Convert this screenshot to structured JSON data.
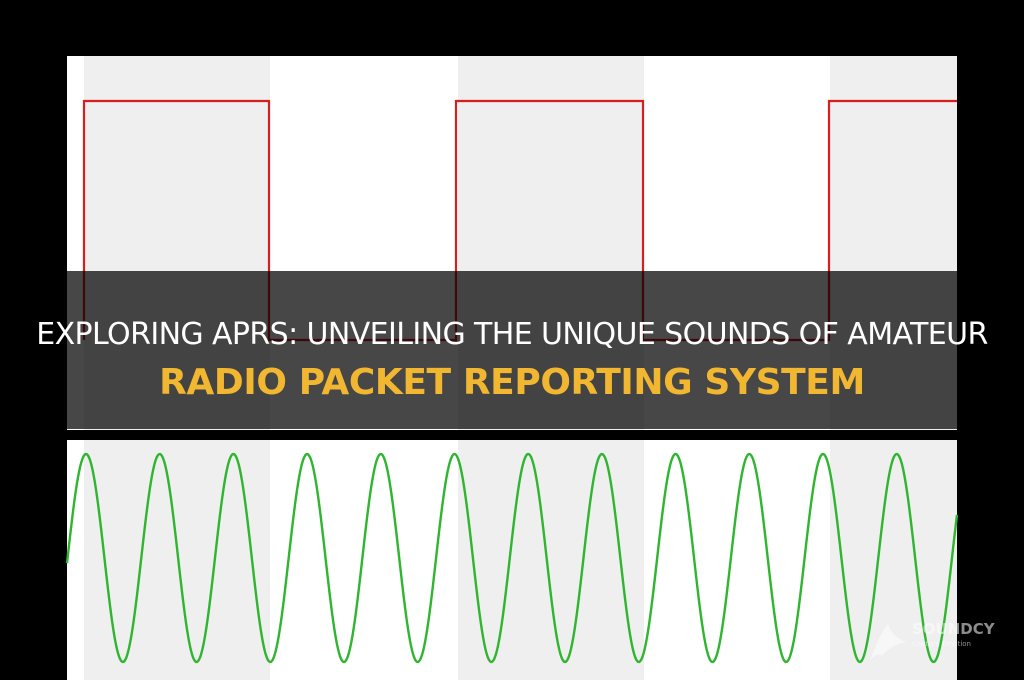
{
  "title": {
    "line1": "EXPLORING APRS: UNVEILING THE UNIQUE SOUNDS OF AMATEUR",
    "line2": "RADIO PACKET REPORTING SYSTEM"
  },
  "watermark": {
    "brand": "SOUNDCY",
    "tagline": "Capture Emotion"
  },
  "colors": {
    "background": "#000000",
    "panel": "#ffffff",
    "band": "#efefef",
    "square_wave": "#d81e1e",
    "sine_wave": "#2fb52f",
    "accent": "#f2b731"
  },
  "icons": {
    "watermark_logo": "dolphin-icon"
  }
}
